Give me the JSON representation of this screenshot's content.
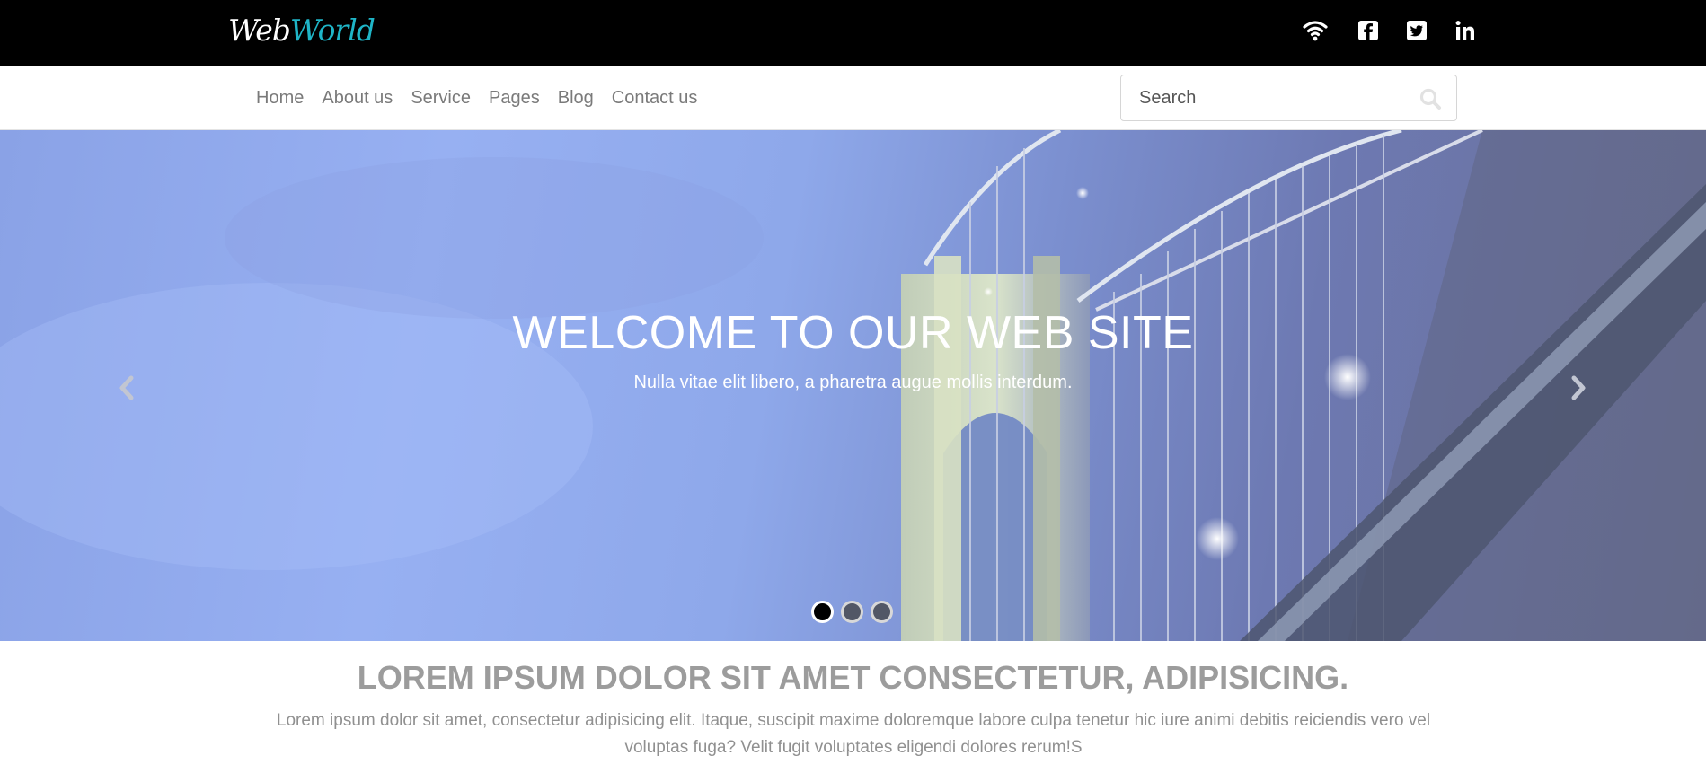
{
  "header": {
    "logo_part1": "Web",
    "logo_part2": "World",
    "social_icons": [
      "wifi-icon",
      "facebook-icon",
      "twitter-icon",
      "linkedin-icon"
    ]
  },
  "nav": {
    "items": [
      "Home",
      "About us",
      "Service",
      "Pages",
      "Blog",
      "Contact us"
    ],
    "search_placeholder": "Search"
  },
  "hero": {
    "title": "WELCOME TO OUR WEB SITE",
    "subtitle": "Nulla vitae elit libero, a pharetra augue mollis interdum.",
    "slide_count": 3,
    "active_slide": 1
  },
  "intro": {
    "heading_normal_1": "LOREM IPSUM DOLOR",
    "heading_bold": "SIT AMET CONSECTETUR,",
    "heading_normal_2": "ADIPISICING.",
    "body": "Lorem ipsum dolor sit amet, consectetur adipisicing elit. Itaque, suscipit maxime doloremque labore culpa tenetur hic iure animi debitis reiciendis vero vel voluptas fuga? Velit fugit voluptates eligendi dolores rerum!S"
  },
  "colors": {
    "topbar": "#000000",
    "logo_accent": "#1fb5c7",
    "nav_text": "#7a7a7a",
    "intro_text": "#909090"
  }
}
